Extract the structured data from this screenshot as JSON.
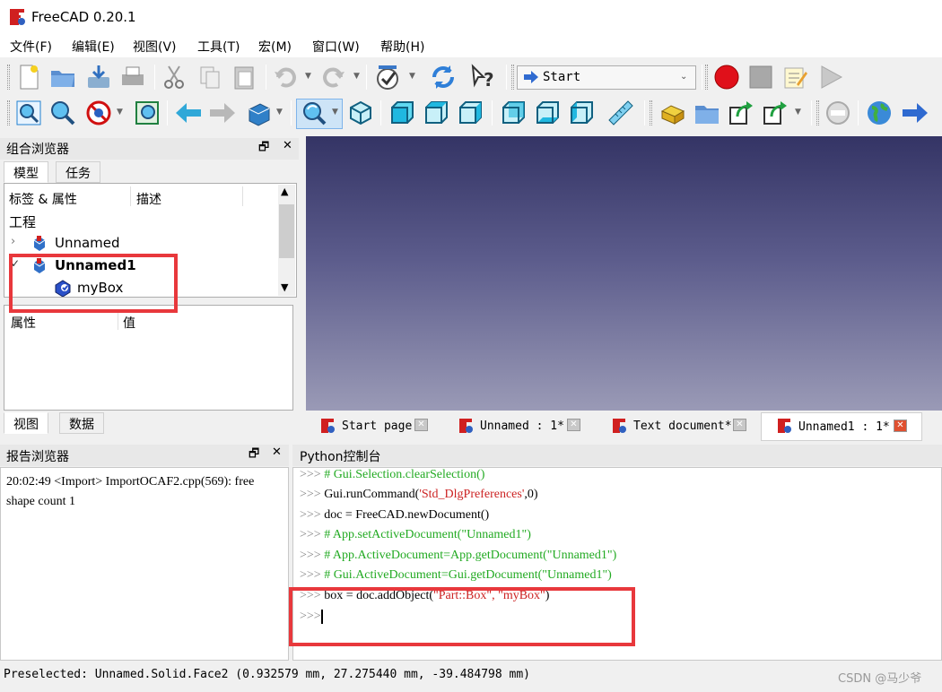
{
  "window": {
    "title": "FreeCAD 0.20.1"
  },
  "menu": [
    "文件(F)",
    "编辑(E)",
    "视图(V)",
    "工具(T)",
    "宏(M)",
    "窗口(W)",
    "帮助(H)"
  ],
  "toolbar": {
    "workbench": "Start"
  },
  "combo": {
    "title": "组合浏览器",
    "tabs": [
      "模型",
      "任务"
    ],
    "tree_headers": [
      "标签 & 属性",
      "描述"
    ],
    "tree_root": "工程",
    "tree_items": [
      "Unnamed",
      "Unnamed1",
      "myBox"
    ],
    "prop_headers": [
      "属性",
      "值"
    ],
    "bottom_tabs": [
      "视图",
      "数据"
    ]
  },
  "doc_tabs": [
    "Start page",
    "Unnamed : 1*",
    "Text document*",
    "Unnamed1 : 1*"
  ],
  "report": {
    "title": "报告浏览器",
    "text": "20:02:49  <Import> ImportOCAF2.cpp(569): free shape count 1"
  },
  "python": {
    "title": "Python控制台",
    "prompt": ">>>",
    "lines": [
      "# Gui.Selection.clearSelection()",
      "Gui.runCommand(",
      "'Std_DlgPreferences'",
      ",0)",
      "doc = FreeCAD.newDocument()",
      "# App.setActiveDocument(\"Unnamed1\")",
      "# App.ActiveDocument=App.getDocument(\"Unnamed1\")",
      "# Gui.ActiveDocument=Gui.getDocument(\"Unnamed1\")",
      "box = doc.addObject(",
      "\"Part::Box\", \"myBox\"",
      ")"
    ]
  },
  "status": {
    "text": "Preselected: Unnamed.Solid.Face2 (0.932579 mm, 27.275440 mm, -39.484798 mm)"
  },
  "watermark": "CSDN @马少爷",
  "colors": {
    "highlight_box": "#e8383c",
    "viewport_top": "#343465",
    "viewport_bottom": "#9a9ab6"
  }
}
